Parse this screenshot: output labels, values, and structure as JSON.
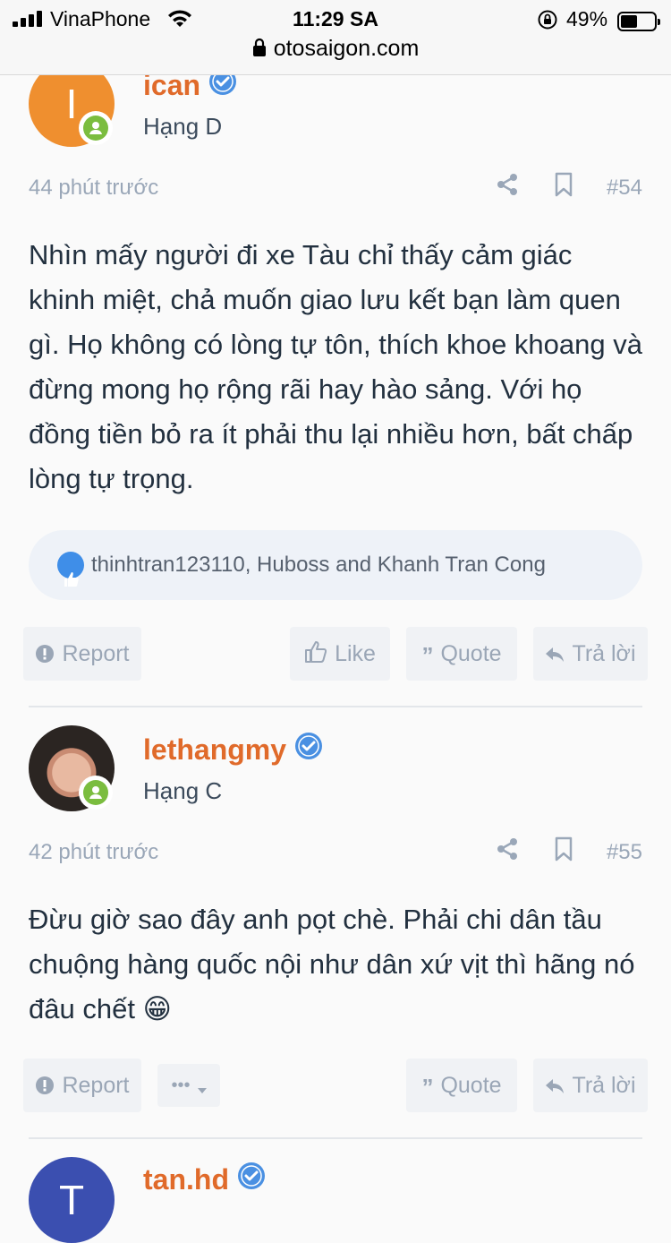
{
  "status_bar": {
    "carrier": "VinaPhone",
    "time": "11:29 SA",
    "battery_pct": "49%",
    "battery_level": 0.49,
    "url": "otosaigon.com"
  },
  "posts": [
    {
      "avatar_letter": "I",
      "avatar_color": "#ef8f2f",
      "username": "ican",
      "rank": "Hạng D",
      "time": "44 phút trước",
      "number": "#54",
      "body": "Nhìn mấy người đi xe Tàu chỉ thấy cảm giác khinh miệt, chả muốn giao lưu kết bạn làm quen gì. Họ không có lòng tự tôn, thích khoe khoang và đừng mong họ rộng rãi hay hào sảng. Với họ đồng tiền bỏ ra ít phải thu lại nhiều hơn, bất chấp lòng tự trọng.",
      "reactions": "thinhtran123110, Huboss and Khanh Tran Cong",
      "buttons": {
        "report": "Report",
        "like": "Like",
        "quote": "Quote",
        "reply": "Trả lời"
      }
    },
    {
      "username": "lethangmy",
      "rank": "Hạng C",
      "time": "42 phút trước",
      "number": "#55",
      "body": "Đừu giờ sao đây anh pọt chè. Phải chi dân tầu chuộng hàng quốc nội như dân xứ vịt thì hãng nó đâu chết",
      "emoji": "😁",
      "buttons": {
        "report": "Report",
        "more": "•••",
        "quote": "Quote",
        "reply": "Trả lời"
      }
    },
    {
      "avatar_letter": "T",
      "avatar_color": "#3b4fb0",
      "username": "tan.hd"
    }
  ],
  "colors": {
    "username": "#e06a2a",
    "verified": "#4a90e2",
    "online": "#7bbd3f",
    "meta": "#9aa7b8"
  }
}
